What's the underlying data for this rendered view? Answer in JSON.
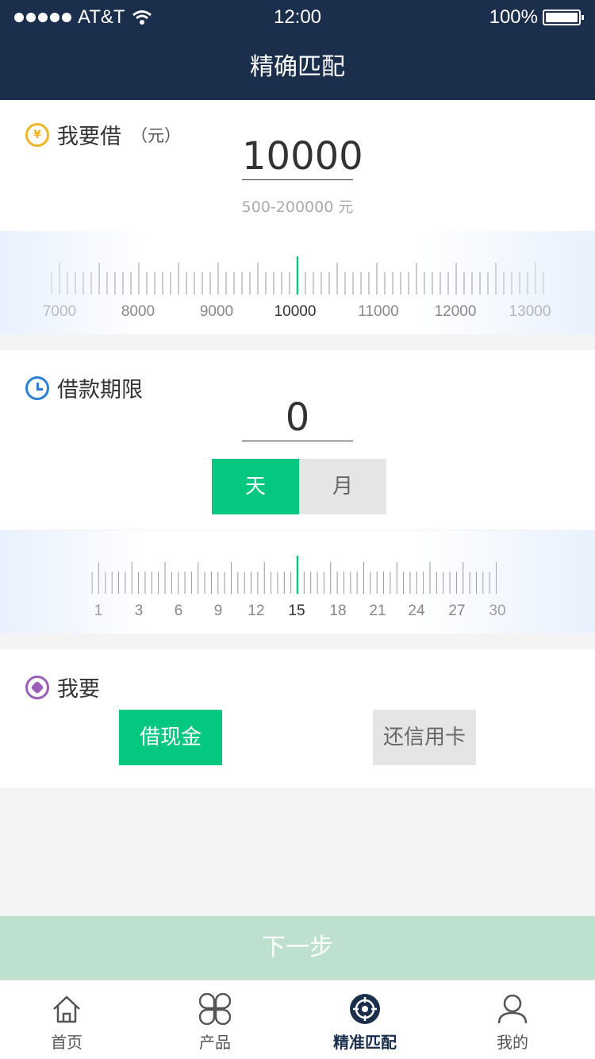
{
  "status": {
    "carrier": "AT&T",
    "time": "12:00",
    "battery": "100%"
  },
  "page_title": "精确匹配",
  "loan": {
    "title": "我要借",
    "unit": "（元）",
    "value": "10000",
    "range": "500-200000 元",
    "ruler_labels": [
      "7000",
      "8000",
      "9000",
      "10000",
      "11000",
      "12000",
      "13000"
    ]
  },
  "term": {
    "title": "借款期限",
    "value": "0",
    "day_label": "天",
    "month_label": "月",
    "ruler_labels": [
      "1",
      "3",
      "6",
      "9",
      "12",
      "15",
      "18",
      "21",
      "24",
      "27",
      "30"
    ]
  },
  "want": {
    "title": "我要",
    "cash_label": "借现金",
    "card_label": "还信用卡"
  },
  "next_label": "下一步",
  "tabs": [
    {
      "label": "首页",
      "icon": "home-icon"
    },
    {
      "label": "产品",
      "icon": "grid-icon"
    },
    {
      "label": "精准匹配",
      "icon": "target-icon"
    },
    {
      "label": "我的",
      "icon": "user-icon"
    }
  ],
  "colors": {
    "nav": "#1b2f4d",
    "accent": "#04c880",
    "next_disabled": "#bde0cf"
  }
}
